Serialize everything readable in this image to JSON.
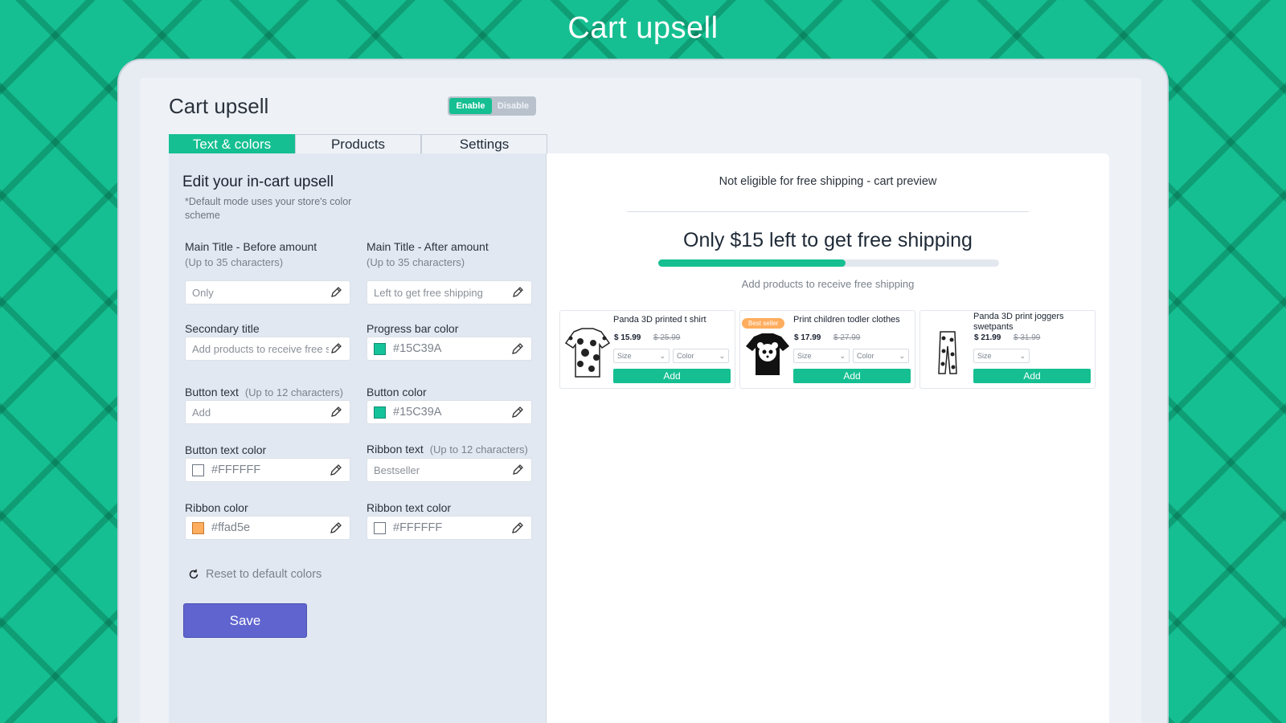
{
  "hero_title": "Cart upsell",
  "panel": {
    "title": "Cart upsell",
    "toggle": {
      "enable": "Enable",
      "disable": "Disable"
    },
    "tabs": [
      "Text & colors",
      "Products",
      "Settings"
    ]
  },
  "editor": {
    "heading": "Edit your in-cart upsell",
    "note": "*Default mode uses your store's color scheme",
    "main_title_before": {
      "label": "Main Title - Before amount",
      "hint": "(Up to 35 characters)",
      "value": "Only"
    },
    "main_title_after": {
      "label": "Main Title - After amount",
      "hint": "(Up to 35 characters)",
      "value": "Left to get free shipping"
    },
    "secondary_title": {
      "label": "Secondary title",
      "value": "Add products to receive free shipping"
    },
    "progress_bar_color": {
      "label": "Progress bar color",
      "value": "#15C39A",
      "swatch": "#15c39a"
    },
    "button_text": {
      "label": "Button text",
      "hint": "(Up to 12 characters)",
      "value": "Add"
    },
    "button_color": {
      "label": "Button color",
      "value": "#15C39A",
      "swatch": "#15c39a"
    },
    "button_text_color": {
      "label": "Button text color",
      "value": "#FFFFFF",
      "swatch": "#ffffff"
    },
    "ribbon_text": {
      "label": "Ribbon text",
      "hint": "(Up to 12 characters)",
      "value": "Bestseller"
    },
    "ribbon_color": {
      "label": "Ribbon color",
      "value": "#ffad5e",
      "swatch": "#ffad5e"
    },
    "ribbon_text_color": {
      "label": "Ribbon text color",
      "value": "#FFFFFF",
      "swatch": "#ffffff"
    },
    "reset_label": "Reset to default colors",
    "save_label": "Save"
  },
  "preview": {
    "title": "Not eligible for free shipping - cart preview",
    "main": "Only $15 left to get free shipping",
    "progress": 0.55,
    "subtitle": "Add products to receive free shipping",
    "products": [
      {
        "name": "Panda 3D printed t shirt",
        "price": "$ 15.99",
        "old_price": "$ 25.99",
        "size": "Size",
        "color": "Color",
        "button": "Add"
      },
      {
        "name": "Print children todler clothes",
        "price": "$ 17.99",
        "old_price": "$ 27.99",
        "size": "Size",
        "color": "Color",
        "button": "Add",
        "ribbon": "Best seller"
      },
      {
        "name": "Panda 3D print joggers swetpants",
        "price": "$ 21.99",
        "old_price": "$ 31.99",
        "size": "Size",
        "button": "Add"
      }
    ]
  },
  "colors": {
    "brand": "#15bf91",
    "save_button": "#5f64cf",
    "ribbon": "#ffad5e"
  }
}
